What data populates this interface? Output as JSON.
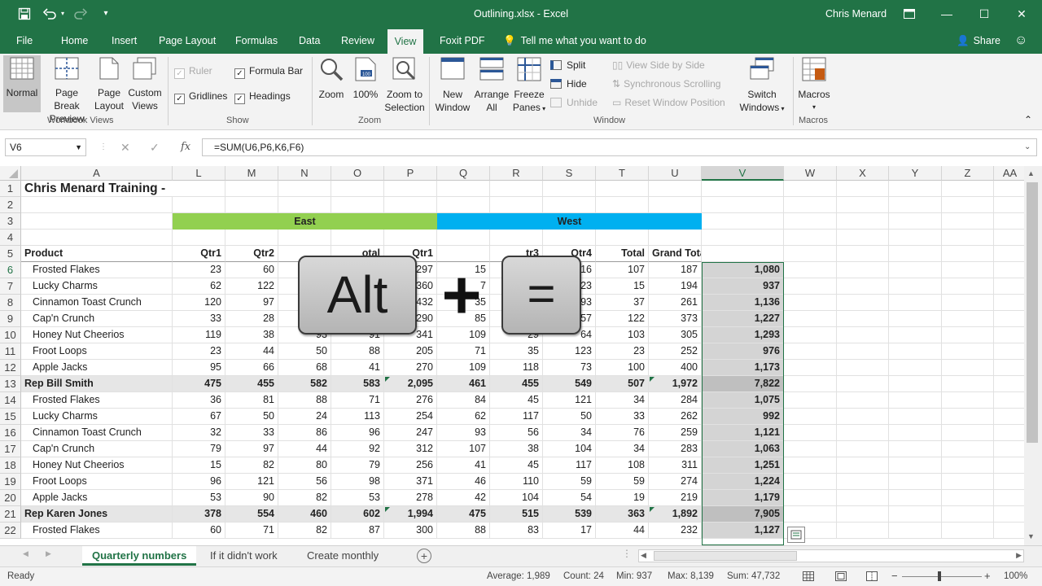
{
  "titlebar": {
    "title": "Outlining.xlsx - Excel",
    "user": "Chris Menard"
  },
  "menu_tabs": [
    "File",
    "Home",
    "Insert",
    "Page Layout",
    "Formulas",
    "Data",
    "Review",
    "View",
    "Foxit PDF"
  ],
  "active_tab": "View",
  "tell_me": "Tell me what you want to do",
  "share": "Share",
  "ribbon": {
    "workbook_views": {
      "label": "Workbook Views",
      "normal": "Normal",
      "page_break": [
        "Page Break",
        "Preview"
      ],
      "page_layout": [
        "Page",
        "Layout"
      ],
      "custom_views": [
        "Custom",
        "Views"
      ]
    },
    "show": {
      "label": "Show",
      "ruler": "Ruler",
      "formula_bar": "Formula Bar",
      "gridlines": "Gridlines",
      "headings": "Headings"
    },
    "zoom": {
      "label": "Zoom",
      "zoom": "Zoom",
      "hundred": "100%",
      "zoom_to_selection": [
        "Zoom to",
        "Selection"
      ]
    },
    "window": {
      "label": "Window",
      "new_window": [
        "New",
        "Window"
      ],
      "arrange_all": [
        "Arrange",
        "All"
      ],
      "freeze_panes": [
        "Freeze",
        "Panes"
      ],
      "split": "Split",
      "hide": "Hide",
      "unhide": "Unhide",
      "view_side_by_side": "View Side by Side",
      "synchronous_scrolling": "Synchronous Scrolling",
      "reset_window_position": "Reset Window Position",
      "switch_windows": [
        "Switch",
        "Windows"
      ]
    },
    "macros": {
      "label": "Macros",
      "macros": "Macros"
    }
  },
  "name_box": "V6",
  "formula": "=SUM(U6,P6,K6,F6)",
  "fx": "fx",
  "columns": [
    "A",
    "L",
    "M",
    "N",
    "O",
    "P",
    "Q",
    "R",
    "S",
    "T",
    "U",
    "V",
    "W",
    "X",
    "Y",
    "Z",
    "AA"
  ],
  "selected_column": "V",
  "row_numbers": [
    1,
    2,
    3,
    4,
    5,
    6,
    7,
    8,
    9,
    10,
    11,
    12,
    13,
    14,
    15,
    16,
    17,
    18,
    19,
    20,
    21,
    22
  ],
  "sheet_title": "Chris Menard Training -",
  "region_labels": {
    "east": "East",
    "west": "West"
  },
  "header_row": [
    "Product",
    "Qtr1",
    "Qtr2",
    "",
    "otal",
    "Qtr1",
    "",
    "tr3",
    "Qtr4",
    "Total",
    "Grand Total"
  ],
  "data_rows": [
    {
      "row": 6,
      "a": "Frosted Flakes",
      "v": [
        "23",
        "60",
        "",
        "",
        "297",
        "15",
        "",
        "16",
        "107",
        "187",
        "1,080"
      ],
      "sum": false
    },
    {
      "row": 7,
      "a": "Lucky Charms",
      "v": [
        "62",
        "122",
        "",
        "",
        "360",
        "7",
        "",
        "23",
        "15",
        "194",
        "937"
      ],
      "sum": false
    },
    {
      "row": 8,
      "a": "Cinnamon Toast Crunch",
      "v": [
        "120",
        "97",
        "",
        "",
        "432",
        "35",
        "",
        "93",
        "37",
        "261",
        "1,136"
      ],
      "sum": false
    },
    {
      "row": 9,
      "a": "Cap'n Crunch",
      "v": [
        "33",
        "28",
        "",
        "",
        "290",
        "85",
        "",
        "57",
        "122",
        "373",
        "1,227"
      ],
      "sum": false
    },
    {
      "row": 10,
      "a": "Honey Nut Cheerios",
      "v": [
        "119",
        "38",
        "93",
        "91",
        "341",
        "109",
        "29",
        "64",
        "103",
        "305",
        "1,293"
      ],
      "sum": false
    },
    {
      "row": 11,
      "a": "Froot Loops",
      "v": [
        "23",
        "44",
        "50",
        "88",
        "205",
        "71",
        "35",
        "123",
        "23",
        "252",
        "976"
      ],
      "sum": false
    },
    {
      "row": 12,
      "a": "Apple Jacks",
      "v": [
        "95",
        "66",
        "68",
        "41",
        "270",
        "109",
        "118",
        "73",
        "100",
        "400",
        "1,173"
      ],
      "sum": false
    },
    {
      "row": 13,
      "a": "Rep Bill Smith",
      "v": [
        "475",
        "455",
        "582",
        "583",
        "2,095",
        "461",
        "455",
        "549",
        "507",
        "1,972",
        "7,822"
      ],
      "sum": true
    },
    {
      "row": 14,
      "a": "Frosted Flakes",
      "v": [
        "36",
        "81",
        "88",
        "71",
        "276",
        "84",
        "45",
        "121",
        "34",
        "284",
        "1,075"
      ],
      "sum": false
    },
    {
      "row": 15,
      "a": "Lucky Charms",
      "v": [
        "67",
        "50",
        "24",
        "113",
        "254",
        "62",
        "117",
        "50",
        "33",
        "262",
        "992"
      ],
      "sum": false
    },
    {
      "row": 16,
      "a": "Cinnamon Toast Crunch",
      "v": [
        "32",
        "33",
        "86",
        "96",
        "247",
        "93",
        "56",
        "34",
        "76",
        "259",
        "1,121"
      ],
      "sum": false
    },
    {
      "row": 17,
      "a": "Cap'n Crunch",
      "v": [
        "79",
        "97",
        "44",
        "92",
        "312",
        "107",
        "38",
        "104",
        "34",
        "283",
        "1,063"
      ],
      "sum": false
    },
    {
      "row": 18,
      "a": "Honey Nut Cheerios",
      "v": [
        "15",
        "82",
        "80",
        "79",
        "256",
        "41",
        "45",
        "117",
        "108",
        "311",
        "1,251"
      ],
      "sum": false
    },
    {
      "row": 19,
      "a": "Froot Loops",
      "v": [
        "96",
        "121",
        "56",
        "98",
        "371",
        "46",
        "110",
        "59",
        "59",
        "274",
        "1,224"
      ],
      "sum": false
    },
    {
      "row": 20,
      "a": "Apple Jacks",
      "v": [
        "53",
        "90",
        "82",
        "53",
        "278",
        "42",
        "104",
        "54",
        "19",
        "219",
        "1,179"
      ],
      "sum": false
    },
    {
      "row": 21,
      "a": "Rep Karen Jones",
      "v": [
        "378",
        "554",
        "460",
        "602",
        "1,994",
        "475",
        "515",
        "539",
        "363",
        "1,892",
        "7,905"
      ],
      "sum": true
    },
    {
      "row": 22,
      "a": "Frosted Flakes",
      "v": [
        "60",
        "71",
        "82",
        "87",
        "300",
        "88",
        "83",
        "17",
        "44",
        "232",
        "1,127"
      ],
      "sum": false
    }
  ],
  "overlay": {
    "key1": "Alt",
    "plus": "+",
    "key2": "="
  },
  "sheets": [
    "Quarterly numbers",
    "If it didn't work",
    "Create monthly"
  ],
  "active_sheet": "Quarterly numbers",
  "status": {
    "ready": "Ready",
    "average": "Average: 1,989",
    "count": "Count: 24",
    "min": "Min: 937",
    "max": "Max: 8,139",
    "sum": "Sum: 47,732",
    "zoom": "100%"
  },
  "colors": {
    "excel_green": "#217346",
    "east": "#92d050",
    "west": "#00b0f0"
  }
}
